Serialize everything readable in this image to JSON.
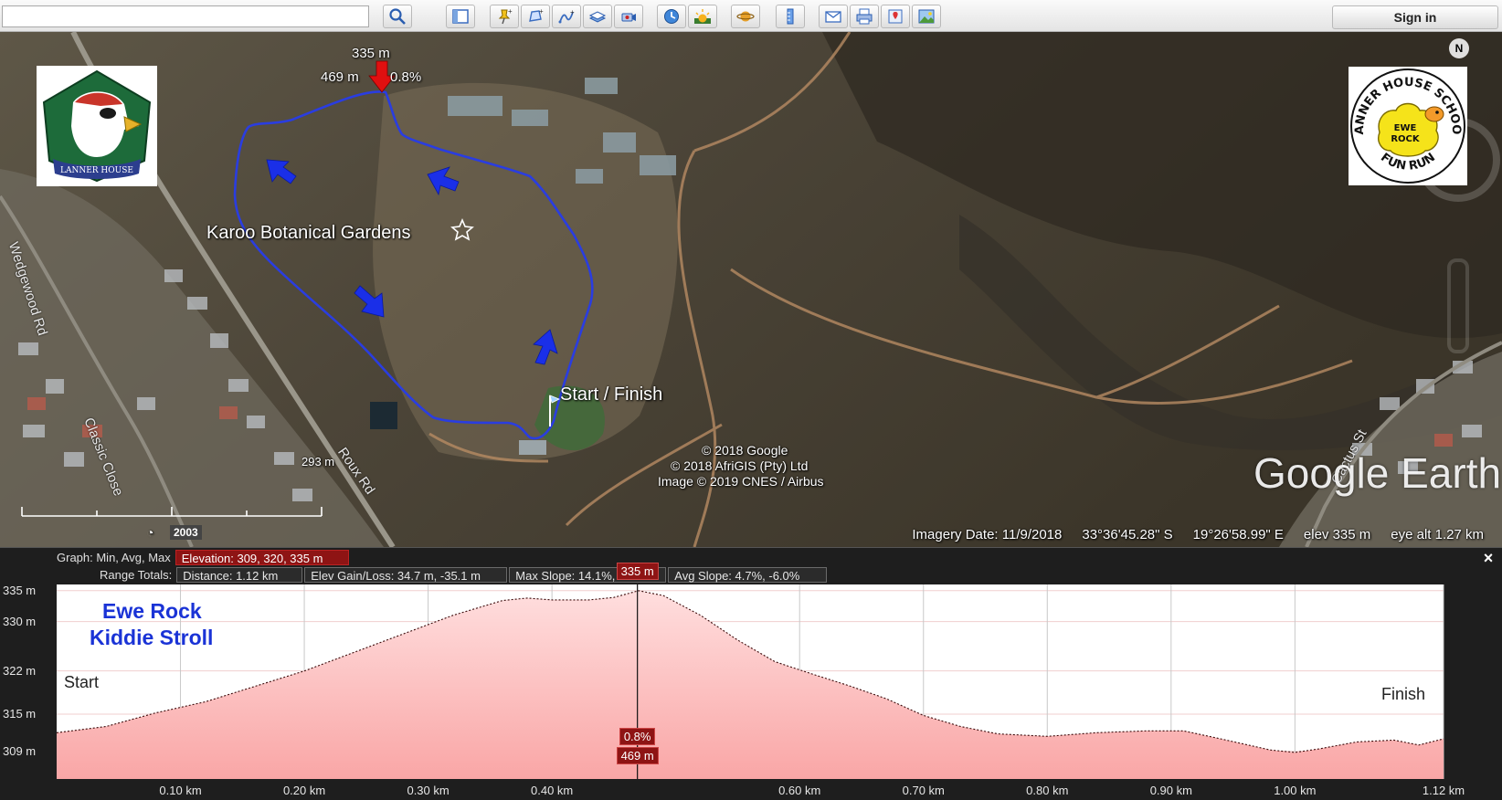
{
  "toolbar": {
    "search_value": "",
    "search_placeholder": "",
    "sign_in_label": "Sign in",
    "buttons": [
      {
        "name": "search-button",
        "icon": "magnifier-icon"
      },
      {
        "name": "sidebar-toggle-button",
        "icon": "sidebar-icon"
      },
      {
        "name": "add-placemark-button",
        "icon": "pushpin-icon"
      },
      {
        "name": "add-polygon-button",
        "icon": "polygon-icon"
      },
      {
        "name": "add-path-button",
        "icon": "path-icon"
      },
      {
        "name": "image-overlay-button",
        "icon": "overlay-icon"
      },
      {
        "name": "record-tour-button",
        "icon": "camera-icon"
      },
      {
        "name": "historical-imagery-button",
        "icon": "clock-icon"
      },
      {
        "name": "sunlight-button",
        "icon": "sun-icon"
      },
      {
        "name": "planets-button",
        "icon": "planet-icon"
      },
      {
        "name": "ruler-button",
        "icon": "ruler-icon"
      },
      {
        "name": "email-button",
        "icon": "envelope-icon"
      },
      {
        "name": "print-button",
        "icon": "printer-icon"
      },
      {
        "name": "google-maps-button",
        "icon": "maps-icon"
      },
      {
        "name": "save-image-button",
        "icon": "image-icon"
      }
    ]
  },
  "map": {
    "marker_elevation": "335 m",
    "marker_distance": "469 m",
    "marker_slope": "0.8%",
    "place_label": "Karoo Botanical Gardens",
    "start_finish_label": "Start / Finish",
    "roads": [
      "Wedgewood Rd",
      "Classic Close",
      "Roux Rd",
      "Cactus St"
    ],
    "scale_label": "293 m",
    "year": "2003",
    "compass": "N",
    "copyright": [
      "© 2018 Google",
      "© 2018 AfriGIS (Pty) Ltd",
      "Image © 2019 CNES / Airbus"
    ],
    "watermark": "Google Earth",
    "status": {
      "imagery_date": "Imagery Date: 11/9/2018",
      "latitude": "33°36'45.28\" S",
      "longitude": "19°26'58.99\" E",
      "elev": "elev   335 m",
      "eye_alt": "eye alt   1.27 km"
    },
    "logo_right_text": [
      "LANNER HOUSE SCHOOL",
      "EWE",
      "ROCK",
      "FUN RUN"
    ],
    "logo_left_text": "LANNER HOUSE"
  },
  "elevation_panel": {
    "graph_label": "Graph: Min, Avg, Max",
    "elevation_summary": "Elevation: 309, 320, 335 m",
    "range_label": "Range Totals:",
    "distance": "Distance: 1.12 km",
    "elev_gain_loss": "Elev Gain/Loss: 34.7 m, -35.1 m",
    "max_slope": "Max Slope: 14.1%, -19.1%",
    "avg_slope": "Avg Slope: 4.7%, -6.0%",
    "close_symbol": "×",
    "chart_title_line1": "Ewe Rock",
    "chart_title_line2": "Kiddie Stroll",
    "start_label": "Start",
    "finish_label": "Finish",
    "cursor_elevation": "335 m",
    "cursor_slope": "0.8%",
    "cursor_distance": "469 m"
  },
  "chart_data": {
    "type": "area",
    "title": "",
    "xlabel": "",
    "ylabel": "",
    "xlim": [
      0,
      1.12
    ],
    "ylim": [
      304.5,
      336
    ],
    "y_ticks": [
      {
        "value": 335,
        "label": "335 m"
      },
      {
        "value": 330,
        "label": "330 m"
      },
      {
        "value": 322,
        "label": "322 m"
      },
      {
        "value": 315,
        "label": "315 m"
      },
      {
        "value": 309,
        "label": "309 m"
      }
    ],
    "x_ticks": [
      {
        "value": 0.1,
        "label": "0.10 km"
      },
      {
        "value": 0.2,
        "label": "0.20 km"
      },
      {
        "value": 0.3,
        "label": "0.30 km"
      },
      {
        "value": 0.4,
        "label": "0.40 km"
      },
      {
        "value": 0.6,
        "label": "0.60 km"
      },
      {
        "value": 0.7,
        "label": "0.70 km"
      },
      {
        "value": 0.8,
        "label": "0.80 km"
      },
      {
        "value": 0.9,
        "label": "0.90 km"
      },
      {
        "value": 1.0,
        "label": "1.00 km"
      },
      {
        "value": 1.12,
        "label": "1.12 km"
      }
    ],
    "cursor_x": 0.469,
    "x": [
      0.0,
      0.04,
      0.08,
      0.12,
      0.16,
      0.2,
      0.24,
      0.28,
      0.32,
      0.36,
      0.38,
      0.4,
      0.43,
      0.45,
      0.47,
      0.49,
      0.52,
      0.55,
      0.58,
      0.61,
      0.64,
      0.67,
      0.7,
      0.73,
      0.76,
      0.8,
      0.84,
      0.88,
      0.91,
      0.94,
      0.98,
      1.0,
      1.02,
      1.05,
      1.08,
      1.1,
      1.12
    ],
    "y": [
      312.0,
      313.0,
      315.2,
      317.0,
      319.5,
      322.0,
      325.0,
      328.0,
      331.0,
      333.4,
      333.8,
      333.5,
      333.5,
      333.9,
      335.0,
      334.2,
      331.0,
      327.0,
      323.5,
      321.5,
      319.6,
      317.5,
      314.8,
      313.0,
      311.8,
      311.4,
      312.0,
      312.3,
      312.3,
      311.0,
      309.2,
      308.8,
      309.4,
      310.5,
      310.8,
      310.0,
      311.0
    ]
  },
  "colors": {
    "route": "#2a3de0",
    "arrow": "#1a2fe8",
    "marker": "#e01010",
    "fill_top": "#ffdede",
    "fill_bottom": "#f9a6a6",
    "highlight": "#8e1414",
    "title": "#1a33d6"
  }
}
